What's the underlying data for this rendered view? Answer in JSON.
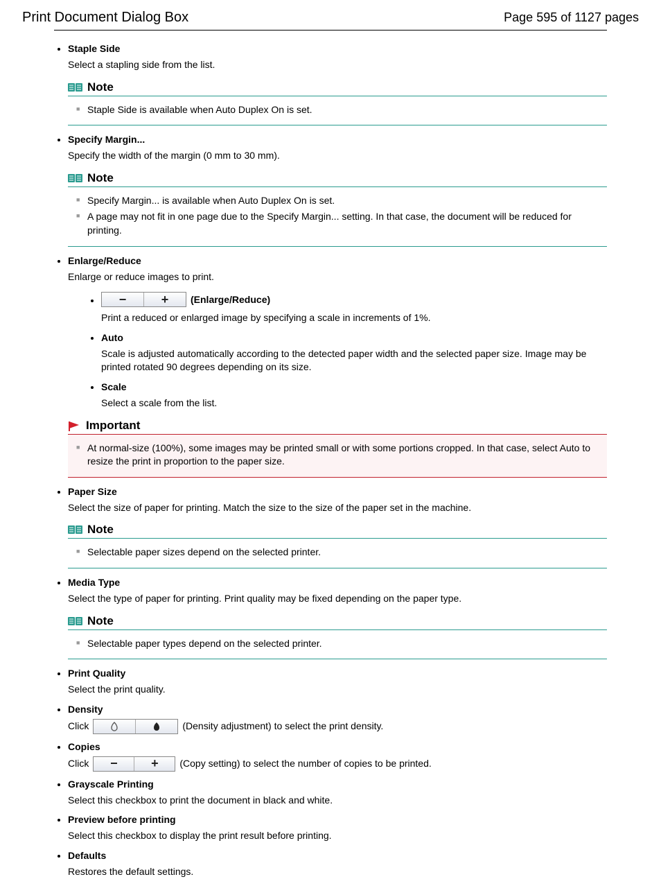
{
  "header": {
    "title": "Print Document Dialog Box",
    "page_indicator": "Page 595 of 1127 pages"
  },
  "callout_labels": {
    "note": "Note",
    "important": "Important"
  },
  "sections": {
    "staple_side": {
      "label": "Staple Side",
      "desc": "Select a stapling side from the list.",
      "note": [
        "Staple Side is available when Auto Duplex On is set."
      ]
    },
    "specify_margin": {
      "label": "Specify Margin...",
      "desc": "Specify the width of the margin (0 mm to 30 mm).",
      "note": [
        "Specify Margin... is available when Auto Duplex On is set.",
        "A page may not fit in one page due to the Specify Margin... setting. In that case, the document will be reduced for printing."
      ]
    },
    "enlarge_reduce": {
      "label": "Enlarge/Reduce",
      "desc": "Enlarge or reduce images to print.",
      "btn_label": "(Enlarge/Reduce)",
      "btn_desc": "Print a reduced or enlarged image by specifying a scale in increments of 1%.",
      "auto_label": "Auto",
      "auto_desc": "Scale is adjusted automatically according to the detected paper width and the selected paper size. Image may be printed rotated 90 degrees depending on its size.",
      "scale_label": "Scale",
      "scale_desc": "Select a scale from the list.",
      "important": [
        "At normal-size (100%), some images may be printed small or with some portions cropped. In that case, select Auto to resize the print in proportion to the paper size."
      ]
    },
    "paper_size": {
      "label": "Paper Size",
      "desc": "Select the size of paper for printing. Match the size to the size of the paper set in the machine.",
      "note": [
        "Selectable paper sizes depend on the selected printer."
      ]
    },
    "media_type": {
      "label": "Media Type",
      "desc": "Select the type of paper for printing. Print quality may be fixed depending on the paper type.",
      "note": [
        "Selectable paper types depend on the selected printer."
      ]
    },
    "print_quality": {
      "label": "Print Quality",
      "desc": "Select the print quality."
    },
    "density": {
      "label": "Density",
      "pre": "Click",
      "post": "(Density adjustment) to select the print density."
    },
    "copies": {
      "label": "Copies",
      "pre": "Click",
      "post": "(Copy setting) to select the number of copies to be printed."
    },
    "grayscale": {
      "label": "Grayscale Printing",
      "desc": "Select this checkbox to print the document in black and white."
    },
    "preview": {
      "label": "Preview before printing",
      "desc": "Select this checkbox to display the print result before printing."
    },
    "defaults": {
      "label": "Defaults",
      "desc": "Restores the default settings."
    }
  }
}
